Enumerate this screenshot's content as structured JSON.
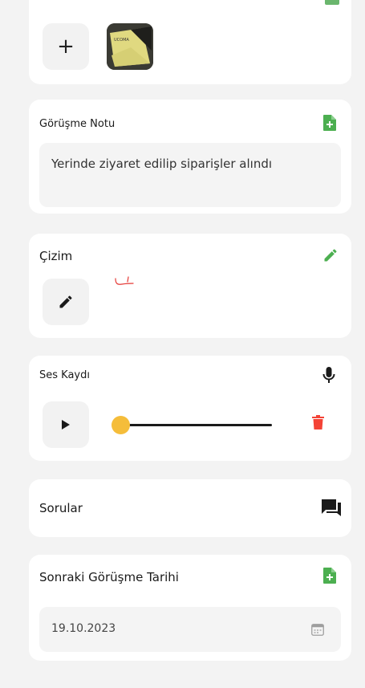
{
  "photos": {
    "add_label": "+",
    "thumbnail_text": "UCOMA"
  },
  "note": {
    "title": "Görüşme Notu",
    "text": "Yerinde ziyaret edilip siparişler alındı"
  },
  "drawing": {
    "title": "Çizim"
  },
  "audio": {
    "title": "Ses Kaydı",
    "progress": 0
  },
  "questions": {
    "title": "Sorular"
  },
  "next_meeting": {
    "title": "Sonraki Görüşme Tarihi",
    "date": "19.10.2023"
  },
  "colors": {
    "accent_green": "#4caf50",
    "delete_red": "#f44336",
    "slider_thumb": "#f5bd3a",
    "background": "#f3f3f3"
  }
}
